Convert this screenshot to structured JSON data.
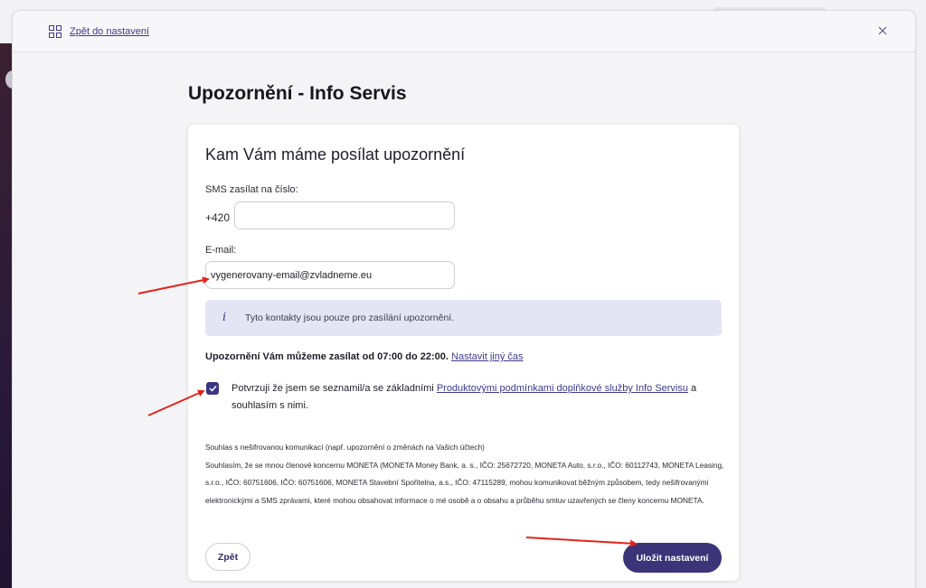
{
  "window": {
    "back_link": "Zpět do nastavení",
    "close_icon": "close-icon"
  },
  "page": {
    "title": "Upozornění - Info Servis"
  },
  "card": {
    "heading": "Kam Vám máme posílat upozornění",
    "sms_label": "SMS zasílat na číslo:",
    "phone_prefix": "+420",
    "phone_value": "",
    "email_label": "E-mail:",
    "email_value": "vygenerovany-email@zvladneme.eu",
    "info_text": "Tyto kontakty jsou pouze pro zasílání upozornění.",
    "time_text": "Upozornění Vám můžeme zasílat od 07:00 do 22:00.",
    "time_link": "Nastavit jiný čas",
    "consent_checked": true,
    "consent_prefix": "Potvrzuji že jsem se seznamil/a se základními ",
    "consent_link": "Produktovými podmínkami doplňkové služby Info Servisu",
    "consent_suffix": " a souhlasím s nimi.",
    "legal_title": "Souhlas s nešifrovanou komunikací (např. upozornění o změnách na Vašich účtech)",
    "legal_body": "Souhlasím, že se mnou členové koncernu MONETA (MONETA Money Bank, a. s., IČO: 25672720, MONETA Auto, s.r.o., IČO: 60112743, MONETA Leasing, s.r.o., IČO: 60751606, IČO: 60751606, MONETA Stavební Spořitelna, a.s., IČO: 47115289, mohou komunikovat běžným způsobem, tedy nešifrovanými elektronickými a SMS zprávami, které mohou obsahovat informace o mé osobě a o obsahu a průběhu smluv uzavřených se členy koncernu MONETA.",
    "back_button": "Zpět",
    "save_button": "Uložit nastavení"
  },
  "colors": {
    "accent": "#3b3478",
    "link": "#3e3a8c",
    "info_bg": "#e4e5f4",
    "annotation_arrow": "#e0261c"
  },
  "icons": [
    "grid-icon",
    "close-icon",
    "info-icon",
    "checkmark-icon",
    "annotation-arrow"
  ]
}
